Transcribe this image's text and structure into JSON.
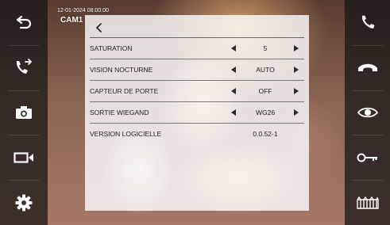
{
  "overlay": {
    "date_time": "12-01-2024  08:00:00",
    "camera": "CAM1"
  },
  "left_sidebar": [
    {
      "name": "back-icon"
    },
    {
      "name": "call-transfer-icon"
    },
    {
      "name": "camera-snapshot-icon"
    },
    {
      "name": "video-record-icon"
    },
    {
      "name": "settings-gear-icon"
    }
  ],
  "right_sidebar": [
    {
      "name": "answer-call-icon",
      "color": "#ffffff"
    },
    {
      "name": "hang-up-icon",
      "color": "#ffffff"
    },
    {
      "name": "monitor-eye-icon",
      "color": "#ffffff"
    },
    {
      "name": "unlock-key-icon",
      "color": "#ffffff"
    },
    {
      "name": "gate-icon",
      "color": "#ffffff"
    }
  ],
  "settings": {
    "rows": [
      {
        "label": "SATURATION",
        "value": "5",
        "adjustable": true
      },
      {
        "label": "VISION NOCTURNE",
        "value": "AUTO",
        "adjustable": true
      },
      {
        "label": "CAPTEUR DE PORTE",
        "value": "OFF",
        "adjustable": true
      },
      {
        "label": "SORTIE WIEGAND",
        "value": "WG26",
        "adjustable": true
      },
      {
        "label": "VERSION LOGICIELLE",
        "value": "0.0.52-1",
        "adjustable": false
      }
    ]
  },
  "colors": {
    "panel_background": "#ffffffcc",
    "sidebar_background": "#141414b8",
    "text": "#222222"
  }
}
